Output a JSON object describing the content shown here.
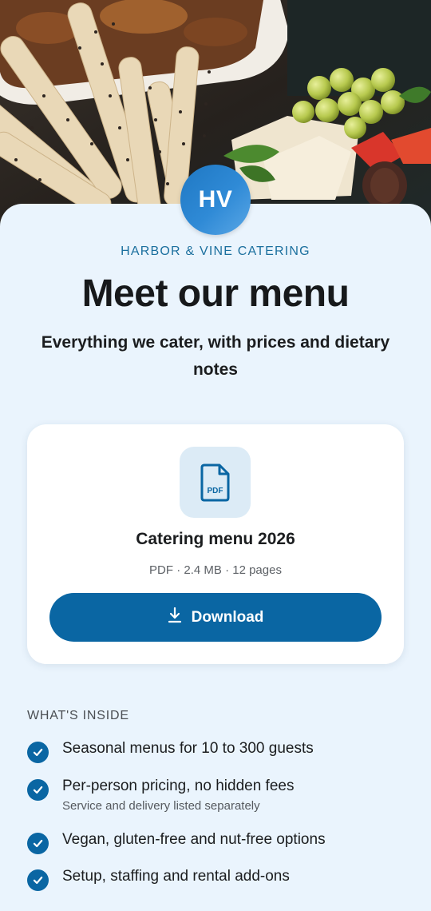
{
  "hero": {
    "image": "catering-food-spread"
  },
  "brand": {
    "initials": "HV",
    "name": "HARBOR & VINE CATERING"
  },
  "header": {
    "title": "Meet our menu",
    "subtitle": "Everything we cater, with prices and dietary notes"
  },
  "download_card": {
    "icon": "pdf-file-icon",
    "icon_label": "PDF",
    "file_name": "Catering menu 2026",
    "file_meta": "PDF · 2.4 MB · 12 pages",
    "button_icon": "download-icon",
    "button_label": "Download"
  },
  "inside": {
    "label": "WHAT'S INSIDE",
    "items": [
      {
        "text": "Seasonal menus for 10 to 300 guests",
        "note": ""
      },
      {
        "text": "Per-person pricing, no hidden fees",
        "note": "Service and delivery listed separately"
      },
      {
        "text": "Vegan, gluten-free and nut-free options",
        "note": ""
      },
      {
        "text": "Setup, staffing and rental add-ons",
        "note": ""
      }
    ]
  },
  "colors": {
    "accent": "#0a66a3",
    "brand_text": "#1b6f9e",
    "page_background": "#eaf4fd",
    "badge_background": "#dcebf6"
  }
}
